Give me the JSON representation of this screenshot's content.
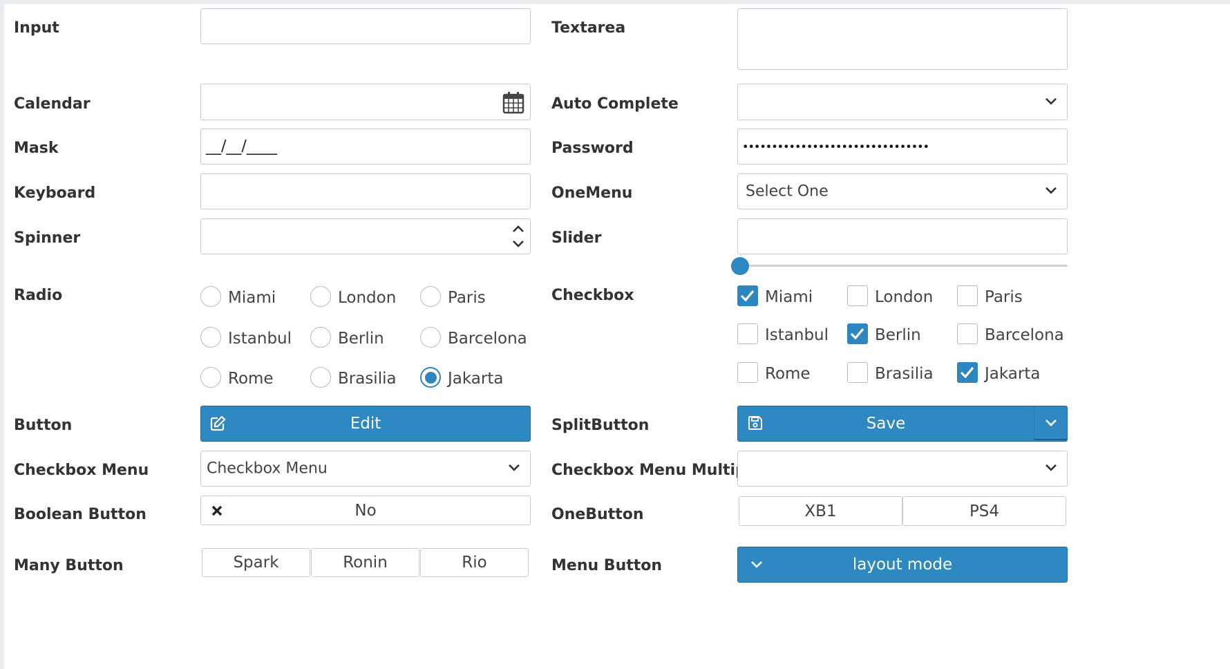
{
  "colors": {
    "accent": "#2e88c2",
    "border": "#c8ccd1",
    "label": "#333333"
  },
  "labels": {
    "input": "Input",
    "textarea": "Textarea",
    "calendar": "Calendar",
    "auto_complete": "Auto Complete",
    "mask": "Mask",
    "password": "Password",
    "keyboard": "Keyboard",
    "onemenu": "OneMenu",
    "spinner": "Spinner",
    "slider": "Slider",
    "radio": "Radio",
    "checkbox": "Checkbox",
    "button": "Button",
    "splitbutton": "SplitButton",
    "checkbox_menu": "Checkbox Menu",
    "checkbox_menu_multiple": "Checkbox Menu Multiple",
    "boolean_button": "Boolean Button",
    "onebutton": "OneButton",
    "many_button": "Many Button",
    "menu_button": "Menu Button"
  },
  "fields": {
    "input_value": "",
    "textarea_value": "",
    "calendar_value": "",
    "auto_complete_value": "",
    "mask_value": "__/__/____",
    "password_value": "••••••••••••••••••••••••••••••••",
    "keyboard_value": "",
    "onemenu_value": "Select One",
    "spinner_value": "",
    "slider_text": "",
    "slider_value": 0
  },
  "icons": {
    "calendar": "calendar-icon",
    "dropdown": "chevron-down-icon",
    "spinner_up": "chevron-up-icon",
    "spinner_down": "chevron-down-icon",
    "edit": "edit-icon",
    "save": "save-icon",
    "boolean_off": "times-icon"
  },
  "radio": {
    "options": [
      "Miami",
      "London",
      "Paris",
      "Istanbul",
      "Berlin",
      "Barcelona",
      "Rome",
      "Brasilia",
      "Jakarta"
    ],
    "selected": "Jakarta"
  },
  "checkbox": {
    "options": [
      "Miami",
      "London",
      "Paris",
      "Istanbul",
      "Berlin",
      "Barcelona",
      "Rome",
      "Brasilia",
      "Jakarta"
    ],
    "checked": [
      "Miami",
      "Berlin",
      "Jakarta"
    ]
  },
  "buttons": {
    "edit": "Edit",
    "save": "Save",
    "checkbox_menu_value": "Checkbox Menu",
    "checkbox_menu_multiple_value": "",
    "boolean_value": "No",
    "onebutton": [
      "XB1",
      "PS4"
    ],
    "manybutton": [
      "Spark",
      "Ronin",
      "Rio"
    ],
    "menu_button": "layout mode"
  }
}
